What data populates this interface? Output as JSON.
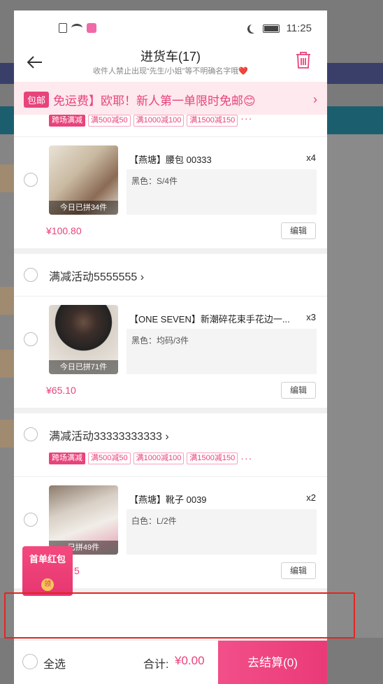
{
  "status_bar": {
    "time": "11:25"
  },
  "header": {
    "title": "进货车(17)",
    "subtitle": "收件人禁止出现“先生/小姐”等不明确名字哦❤️"
  },
  "promo": {
    "badge": "包邮",
    "text": "免运费】欧耶！新人第一单限时免邮😊"
  },
  "top_tags": [
    "跨场满减",
    "满500减50",
    "满1000减100",
    "满1500减150"
  ],
  "items": [
    {
      "name": "【燕塘】腰包 00333",
      "qty": "x4",
      "spec": "黑色：S/4件",
      "caption": "今日已拼34件",
      "price": "¥100.80",
      "edit": "编辑"
    },
    {
      "name": "【ONE SEVEN】新潮碎花束手花边一...",
      "qty": "x3",
      "spec": "黑色：均码/3件",
      "caption": "今日已拼71件",
      "price": "¥65.10",
      "edit": "编辑"
    },
    {
      "name": "【燕塘】靴子 0039",
      "qty": "x2",
      "spec": "白色：L/2件",
      "caption": "已拼49件",
      "price": "5",
      "edit": "编辑"
    }
  ],
  "shops": [
    {
      "name": "满减活动5555555 ›"
    },
    {
      "name": "满减活动33333333333 ›",
      "tags": [
        "跨场满减",
        "满500减50",
        "满1000减100",
        "满1500减150"
      ]
    }
  ],
  "red_packet": {
    "label": "首单红包",
    "coin": "领"
  },
  "bottom": {
    "select_all": "全选",
    "total_label": "合计:",
    "total_value": "¥0.00",
    "checkout": "去结算(0)"
  },
  "colors": {
    "accent": "#e8437b",
    "highlight": "#e2251f"
  }
}
